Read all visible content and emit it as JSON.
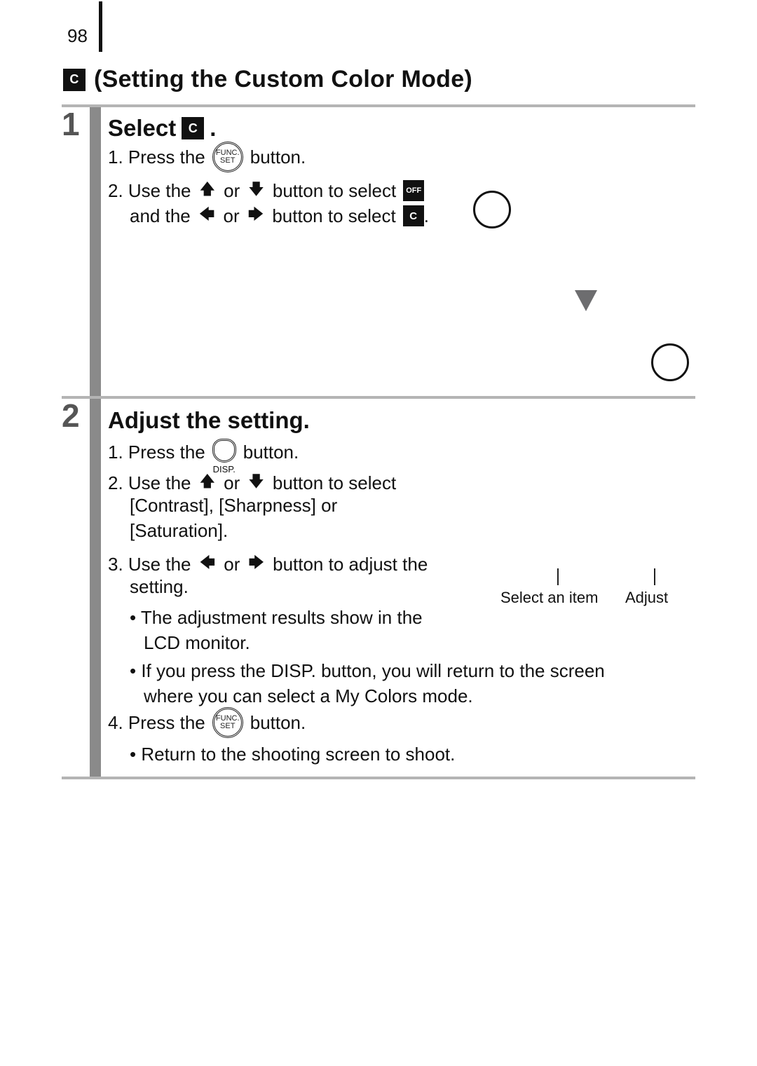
{
  "page": {
    "number": "98"
  },
  "section": {
    "icon": "custom-color-icon",
    "icon_text": "C",
    "title": "(Setting the Custom Color Mode)"
  },
  "steps": [
    {
      "number": "1",
      "heading": "Select",
      "heading_suffix": ".",
      "lines": {
        "l1_pre": "1. Press the",
        "l1_icon": "FUNC.\nSET",
        "l1_post": "button.",
        "l2_a": "2. Use the",
        "l2_up": "▲",
        "l2_or": "or",
        "l2_down": "▼",
        "l2_b": "button to select",
        "l3_a": "and the",
        "l3_left": "◀",
        "l3_or": "or",
        "l3_right": "▶",
        "l3_b": "button to select",
        "l3_end": "."
      },
      "icons": {
        "off": "OFF",
        "custom": "C"
      }
    },
    {
      "number": "2",
      "heading": "Adjust the setting.",
      "lines": {
        "l1_pre": "1. Press the",
        "l1_disp": "DISP.",
        "l1_post": "button.",
        "l2_a": "2. Use the",
        "l2_or": "or",
        "l2_b": "button to select",
        "l2_c": "[Contrast], [Sharpness] or",
        "l2_d": "[Saturation].",
        "l3_a": "3. Use the",
        "l3_or": "or",
        "l3_b": "button to adjust the",
        "l3_c": "setting.",
        "b1_a": "• The adjustment results show in the",
        "b1_b": "LCD monitor.",
        "b2_a": "• If you press the DISP. button, you will return to the screen",
        "b2_b": "where you can select a My Colors mode.",
        "l4_pre": "4. Press the",
        "l4_post": "button.",
        "b3": "• Return to the shooting screen to shoot."
      },
      "callouts": {
        "select": "Select an item",
        "adjust": "Adjust"
      }
    }
  ],
  "colors": {
    "step_bar": "#8a8a8a",
    "divider": "#b4b4b4",
    "triangle": "#6d6d6f"
  }
}
